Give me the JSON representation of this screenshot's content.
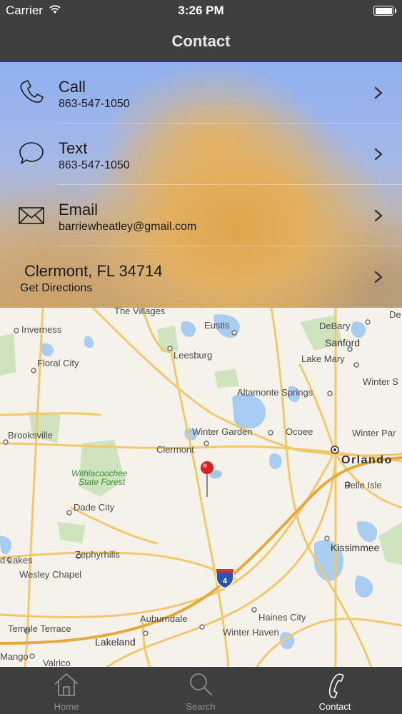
{
  "status_bar": {
    "carrier": "Carrier",
    "time": "3:26 PM"
  },
  "navbar": {
    "title": "Contact"
  },
  "contact": {
    "call": {
      "label": "Call",
      "value": "863-547-1050",
      "icon": "phone-icon"
    },
    "text": {
      "label": "Text",
      "value": "863-547-1050",
      "icon": "chat-bubble-icon"
    },
    "email": {
      "label": "Email",
      "value": "barriewheatley@gmail.com",
      "icon": "envelope-icon"
    },
    "address": {
      "label": "Clermont, FL 34714",
      "sub": "Get Directions"
    }
  },
  "map": {
    "labels": {
      "the_villages": "The Villages",
      "inverness": "Inverness",
      "eustis": "Eustis",
      "debary": "DeBary",
      "sanford": "Sanford",
      "leesburg": "Leesburg",
      "floral_city": "Floral City",
      "lake_mary": "Lake Mary",
      "winter_s": "Winter S",
      "altamonte": "Altamonte Springs",
      "brooksville": "Brooksville",
      "winter_garden": "Winter Garden",
      "ocoee": "Ocoee",
      "winter_par": "Winter Par",
      "clermont": "Clermont",
      "orlando": "Orlando",
      "withlacoochee": "Withlacoochee",
      "state_forest": "State Forest",
      "belle_isle": "Belle Isle",
      "dade_city": "Dade City",
      "kissimmee": "Kissimmee",
      "lakes": "d Lakes",
      "zephyrhills": "Zephyrhills",
      "wesley_chapel": "Wesley Chapel",
      "i4": "4",
      "haines_city": "Haines City",
      "auburndale": "Auburndale",
      "temple_terrace": "Temple Terrace",
      "winter_haven": "Winter Haven",
      "lakeland": "Lakeland",
      "mango": "Mango",
      "valrico": "Valrico",
      "de": "De"
    }
  },
  "tabs": [
    {
      "label": "Home",
      "icon": "home-icon"
    },
    {
      "label": "Search",
      "icon": "search-icon"
    },
    {
      "label": "Contact",
      "icon": "phone-icon",
      "active": true
    }
  ]
}
